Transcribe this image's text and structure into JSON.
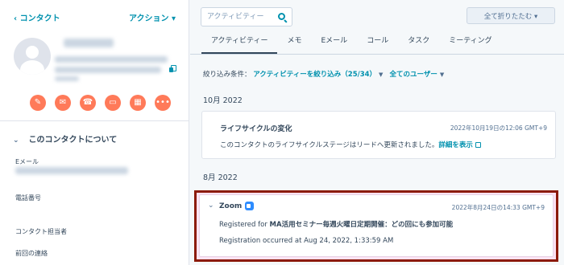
{
  "sidebar": {
    "back_label": "‹ コンタクト",
    "actions_label": "アクション ▾",
    "action_buttons": [
      "note-icon",
      "email-icon",
      "call-icon",
      "task-icon",
      "meeting-icon",
      "more-icon"
    ],
    "section_title": "このコンタクトについて",
    "properties": {
      "email": "Eメール",
      "phone": "電話番号",
      "owner": "コンタクト担当者",
      "last_contacted": "前回の連絡"
    }
  },
  "main": {
    "search_placeholder": "アクティビティー",
    "collapse_all": "全て折りたたむ ▾",
    "tabs": [
      "アクティビティー",
      "メモ",
      "Eメール",
      "コール",
      "タスク",
      "ミーティング"
    ],
    "filter": {
      "label": "絞り込み条件：",
      "activity_filter": "アクティビティーを絞り込み（25/34）",
      "user_filter": "全てのユーザー"
    },
    "months": [
      "10月 2022",
      "8月 2022"
    ],
    "lifecycle_card": {
      "title": "ライフサイクルの変化",
      "time": "2022年10月19日の12:06 GMT+9",
      "text": "このコンタクトのライフサイクルステージはリードへ更新されました。",
      "link": "詳細を表示"
    },
    "zoom_card": {
      "title": "Zoom",
      "time": "2022年8月24日の14:33 GMT+9",
      "registered_prefix": "Registered for ",
      "registered_event": "MA活用セミナー毎週火曜日定期開催：どの回にも参加可能",
      "occurred": "Registration occurred at Aug 24, 2022, 1:33:59 AM"
    }
  },
  "colors": {
    "accent": "#0091ae",
    "action_orange": "#ff7a59",
    "highlight_border": "#8b1a07",
    "highlight_fill": "#fbe2f2",
    "zoom_blue": "#2d8cff"
  }
}
